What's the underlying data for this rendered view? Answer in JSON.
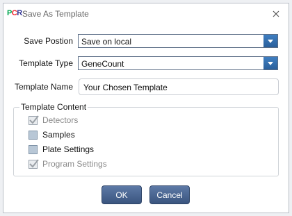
{
  "window": {
    "title": "Save As Template",
    "logo_text": [
      "P",
      "C",
      "R"
    ]
  },
  "form": {
    "save_position": {
      "label": "Save Postion",
      "value": "Save on local"
    },
    "template_type": {
      "label": "Template Type",
      "value": "GeneCount"
    },
    "template_name": {
      "label": "Template Name",
      "value": "Your Chosen Template"
    }
  },
  "template_content": {
    "title": "Template Content",
    "items": [
      {
        "label": "Detectors",
        "checked": true,
        "disabled": true
      },
      {
        "label": "Samples",
        "checked": false,
        "disabled": false
      },
      {
        "label": "Plate Settings",
        "checked": false,
        "disabled": false
      },
      {
        "label": "Program Settings",
        "checked": true,
        "disabled": true
      }
    ]
  },
  "buttons": {
    "ok": "OK",
    "cancel": "Cancel"
  },
  "colors": {
    "accent": "#3a557f",
    "logo": [
      "#00a651",
      "#ed1c24",
      "#2e3192"
    ]
  }
}
